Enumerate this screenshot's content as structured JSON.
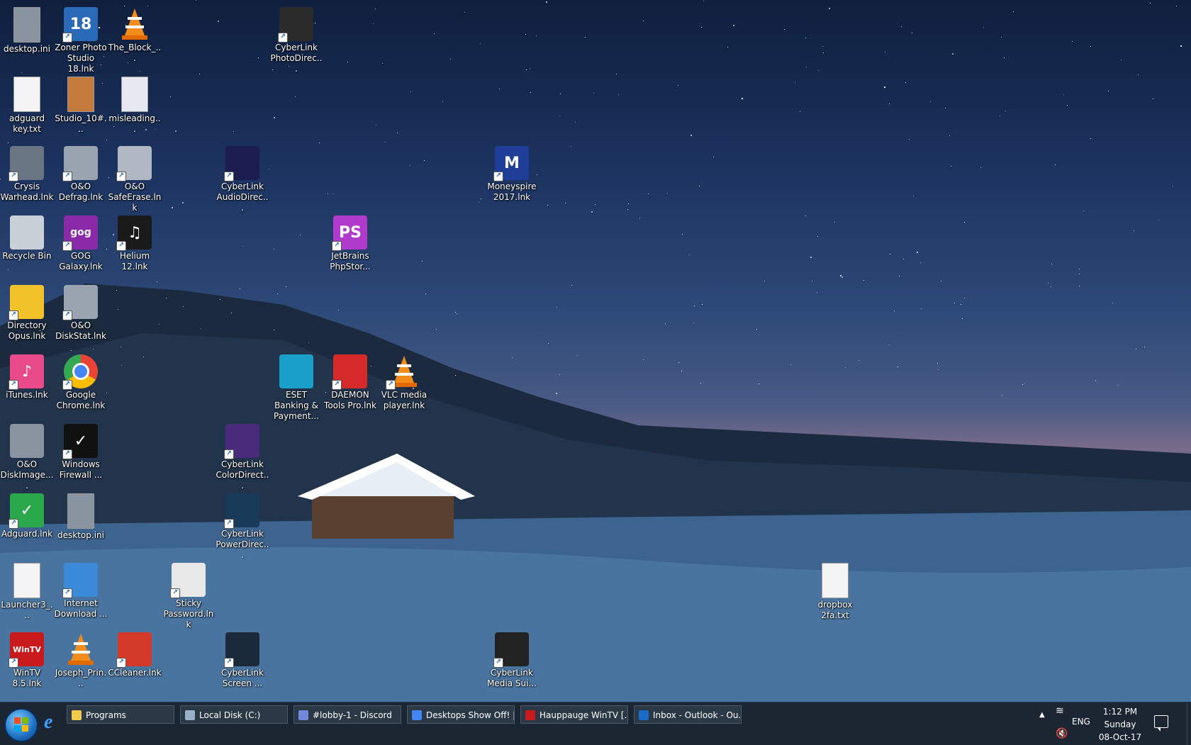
{
  "desktop": {
    "icons": [
      {
        "label": "desktop.ini",
        "icon": "ini-file-icon",
        "color": "#8a94a0"
      },
      {
        "label": "Zoner Photo Studio 18.lnk",
        "icon": "zoner-icon",
        "color": "#2a6ab8",
        "glyph": "18"
      },
      {
        "label": "The_Block_...",
        "icon": "vlc-cone-icon",
        "color": "#f28c1a"
      },
      {
        "label": "CyberLink PhotoDirec...",
        "icon": "photodirector-icon",
        "color": "#2b2b2b"
      },
      {
        "label": "adguard key.txt",
        "icon": "text-file-icon",
        "color": "#f4f4f4"
      },
      {
        "label": "Studio_10#...",
        "icon": "image-file-icon",
        "color": "#c47a3a"
      },
      {
        "label": "misleading...",
        "icon": "image-file-icon",
        "color": "#e8e8f0"
      },
      {
        "label": "Crysis Warhead.lnk",
        "icon": "crysis-icon",
        "color": "#6a7584"
      },
      {
        "label": "O&O Defrag.lnk",
        "icon": "oo-defrag-icon",
        "color": "#9aa4b0"
      },
      {
        "label": "O&O SafeErase.lnk",
        "icon": "oo-safeerase-icon",
        "color": "#b0b8c4"
      },
      {
        "label": "CyberLink AudioDirec...",
        "icon": "audiodirector-icon",
        "color": "#1c1c50"
      },
      {
        "label": "Moneyspire 2017.lnk",
        "icon": "moneyspire-icon",
        "color": "#1f3e9a",
        "glyph": "M"
      },
      {
        "label": "Recycle Bin",
        "icon": "recycle-bin-icon",
        "color": "#c8d0d8"
      },
      {
        "label": "GOG Galaxy.lnk",
        "icon": "gog-icon",
        "color": "#8a2aa8",
        "glyph": "gog"
      },
      {
        "label": "Helium 12.lnk",
        "icon": "helium-music-icon",
        "color": "#1a1a1a",
        "glyph": "♫"
      },
      {
        "label": "JetBrains PhpStor...",
        "icon": "phpstorm-icon",
        "color": "#b03acc",
        "glyph": "PS"
      },
      {
        "label": "Directory Opus.lnk",
        "icon": "directory-opus-icon",
        "color": "#f2c22a"
      },
      {
        "label": "O&O DiskStat.lnk",
        "icon": "oo-diskstat-icon",
        "color": "#9aa4b0"
      },
      {
        "label": "iTunes.lnk",
        "icon": "itunes-icon",
        "color": "#e84a8a",
        "glyph": "♪"
      },
      {
        "label": "Google Chrome.lnk",
        "icon": "chrome-icon",
        "color": "#4285f4"
      },
      {
        "label": "ESET Banking & Payment...",
        "icon": "eset-icon",
        "color": "#1aa0c8"
      },
      {
        "label": "DAEMON Tools Pro.lnk",
        "icon": "daemon-tools-icon",
        "color": "#d42a2a"
      },
      {
        "label": "VLC media player.lnk",
        "icon": "vlc-cone-icon",
        "color": "#f28c1a"
      },
      {
        "label": "O&O DiskImage....",
        "icon": "oo-diskimage-icon",
        "color": "#8a94a0"
      },
      {
        "label": "Windows Firewall ...",
        "icon": "firewall-check-icon",
        "color": "#111111",
        "glyph": "✓"
      },
      {
        "label": "CyberLink ColorDirect...",
        "icon": "colordirector-icon",
        "color": "#4a2a7a"
      },
      {
        "label": "Adguard.lnk",
        "icon": "adguard-shield-icon",
        "color": "#2aa84a",
        "glyph": "✓"
      },
      {
        "label": "desktop.ini",
        "icon": "ini-file-icon",
        "color": "#8a94a0"
      },
      {
        "label": "CyberLink PowerDirec...",
        "icon": "powerdirector-icon",
        "color": "#1a3a5a"
      },
      {
        "label": "Launcher3_...",
        "icon": "blank-file-icon",
        "color": "#f4f4f4"
      },
      {
        "label": "Internet Download ...",
        "icon": "idm-globe-icon",
        "color": "#3a8ad8"
      },
      {
        "label": "Sticky Password.lnk",
        "icon": "sticky-password-icon",
        "color": "#e8e8e8"
      },
      {
        "label": "dropbox 2fa.txt",
        "icon": "text-file-icon",
        "color": "#f4f4f4"
      },
      {
        "label": "WinTV 8.5.lnk",
        "icon": "wintv-icon",
        "color": "#c81a1a",
        "glyph": "WinTV"
      },
      {
        "label": "Joseph_Prin...",
        "icon": "vlc-cone-icon",
        "color": "#f28c1a"
      },
      {
        "label": "CCleaner.lnk",
        "icon": "ccleaner-icon",
        "color": "#d43a2a"
      },
      {
        "label": "CyberLink Screen ...",
        "icon": "screen-recorder-icon",
        "color": "#1a2a3a"
      },
      {
        "label": "CyberLink Media Sui...",
        "icon": "media-suite-icon",
        "color": "#222222"
      }
    ]
  },
  "taskbar": {
    "tasks": [
      {
        "label": "Programs",
        "icon": "folder-icon",
        "color": "#f2c94c"
      },
      {
        "label": "Local Disk (C:)",
        "icon": "drive-icon",
        "color": "#9ab0c8"
      },
      {
        "label": "#lobby-1 - Discord",
        "icon": "discord-icon",
        "color": "#7289da"
      },
      {
        "label": "Desktops Show Off! |...",
        "icon": "chrome-icon",
        "color": "#4285f4"
      },
      {
        "label": "Hauppauge WinTV [...",
        "icon": "wintv-icon",
        "color": "#c81a1a"
      },
      {
        "label": "Inbox - Outlook - Ou...",
        "icon": "outlook-icon",
        "color": "#1a6ac8"
      }
    ],
    "tray": {
      "language": "ENG",
      "time": "1:12 PM",
      "day": "Sunday",
      "date": "08-Oct-17"
    }
  }
}
